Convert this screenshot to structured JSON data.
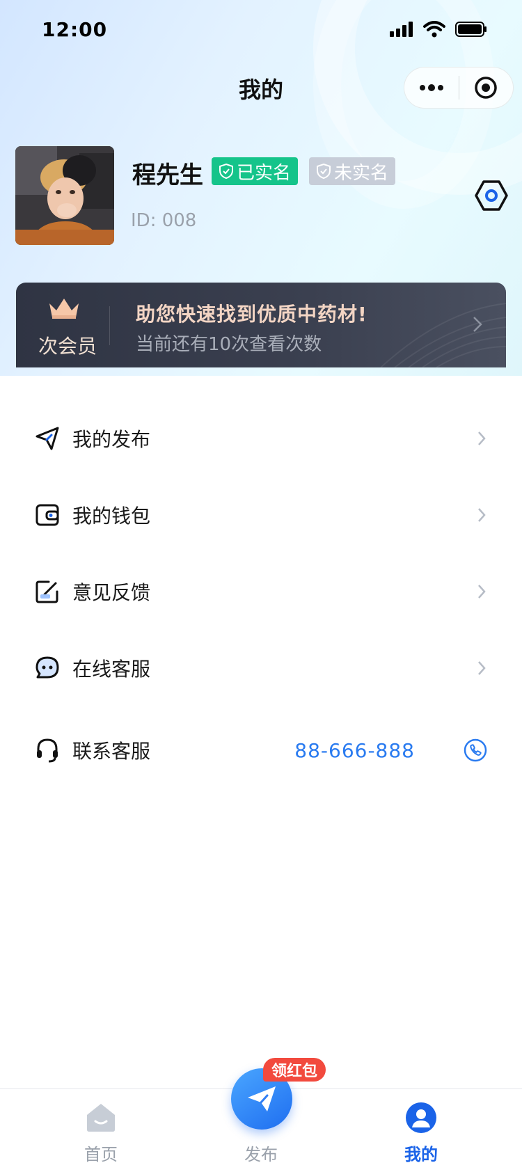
{
  "status_bar": {
    "time": "12:00"
  },
  "nav": {
    "title": "我的"
  },
  "profile": {
    "name": "程先生",
    "badge_verified": "已实名",
    "badge_unverified": "未实名",
    "id_text": "ID: 008"
  },
  "member": {
    "label": "次会员",
    "headline": "助您快速找到优质中药材!",
    "subtitle": "当前还有10次查看次数"
  },
  "menu": {
    "items": [
      {
        "label": "我的发布",
        "icon": "send-icon"
      },
      {
        "label": "我的钱包",
        "icon": "wallet-icon"
      },
      {
        "label": "意见反馈",
        "icon": "feedback-icon"
      },
      {
        "label": "在线客服",
        "icon": "chat-icon"
      }
    ],
    "contact": {
      "label": "联系客服",
      "phone": "88-666-888",
      "icon": "headset-icon"
    }
  },
  "tabs": {
    "home": "首页",
    "publish": "发布",
    "mine": "我的",
    "publish_badge": "领红包"
  },
  "colors": {
    "accent": "#1a63e8",
    "verified": "#15c48a",
    "unverified": "#c7cdd8",
    "phone": "#2a7bf0",
    "badge_red": "#f24a3e"
  }
}
